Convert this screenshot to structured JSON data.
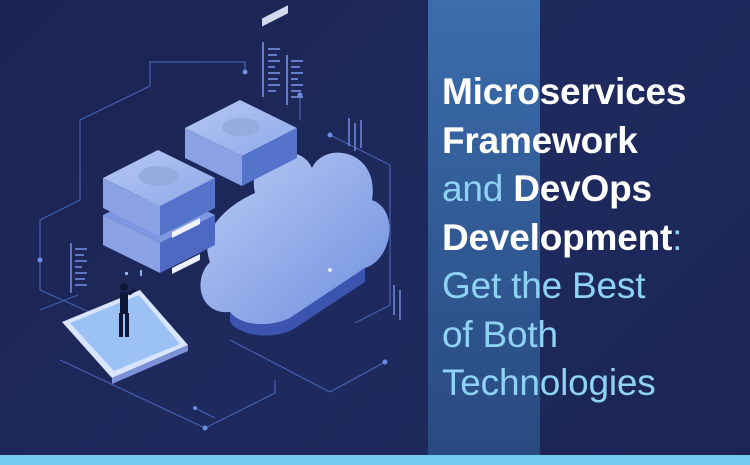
{
  "colors": {
    "background": "#1c2656",
    "stripe": "#3a6aa9",
    "accent_light": "#8fd3f4",
    "bottom_bar": "#74c9ef",
    "heading_white": "#ffffff"
  },
  "illustration": {
    "icons": [
      "server-rack-icon",
      "cloud-icon",
      "smartphone-icon",
      "person-icon",
      "data-panel-icon"
    ]
  },
  "headline": {
    "line1": "Microservices",
    "line2": "Framework",
    "line3_a": "and",
    "line3_b": "DevOps",
    "line4_a": "Development",
    "line4_b": ":",
    "line5": "Get the Best",
    "line6": "of Both",
    "line7": "Technologies"
  }
}
